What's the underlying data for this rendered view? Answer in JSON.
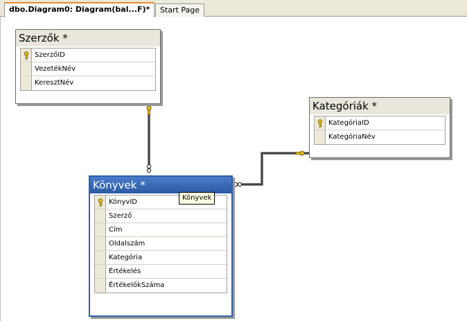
{
  "tabs": [
    {
      "label": "dbo.Diagram0: Diagram(bal...F)*",
      "active": true
    },
    {
      "label": "Start Page",
      "active": false
    }
  ],
  "tables": {
    "szerzok": {
      "title": "Szerzők *",
      "columns": [
        "SzerzőID",
        "VezetékNév",
        "KeresztNév"
      ]
    },
    "kategoriak": {
      "title": "Kategóriák *",
      "columns": [
        "KategóriaID",
        "KategóriaNév"
      ]
    },
    "konyvek": {
      "title": "Könyvek *",
      "columns": [
        "KönyvID",
        "Szerző",
        "Cím",
        "Oldalszám",
        "Kategória",
        "Értékelés",
        "ÉrtékelőkSzáma"
      ]
    }
  },
  "tooltip": "Könyvek",
  "colors": {
    "selected_table": "#2f5fa8",
    "key": "#d4a017",
    "relationship": "#404040"
  }
}
